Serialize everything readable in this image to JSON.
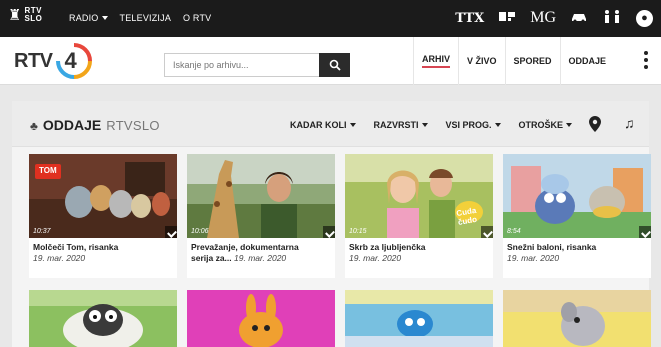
{
  "topbar": {
    "logo_text_top": "RTV",
    "logo_text_bottom": "SLO",
    "nav": [
      {
        "label": "RADIO",
        "dropdown": true
      },
      {
        "label": "TELEVIZIJA",
        "dropdown": false
      },
      {
        "label": "O RTV",
        "dropdown": false
      }
    ],
    "ttx_label": "TTX",
    "mg_label": "MG"
  },
  "header": {
    "brand_rtv": "RTV",
    "brand_num": "4",
    "search_placeholder": "Iskanje po arhivu...",
    "nav": [
      "ARHIV",
      "V ŽIVO",
      "SPORED",
      "ODDAJE"
    ],
    "active_nav": "ARHIV"
  },
  "panel": {
    "title": "ODDAJE",
    "subtitle": "RTVSLO",
    "filters": [
      "KADAR KOLI",
      "RAZVRSTI",
      "VSI PROG.",
      "OTROŠKE"
    ]
  },
  "cards": [
    {
      "title": "Molčeči Tom, risanka",
      "date": "19. mar. 2020",
      "duration": "10:37",
      "thumb_label": "TOM"
    },
    {
      "title": "Prevažanje, dokumentarna serija za...",
      "title_line1": "Prevažanje, dokumentarna",
      "title_line2": "serija za...",
      "date": "19. mar. 2020",
      "duration": "10:06"
    },
    {
      "title": "Skrb za ljubljenčka",
      "date": "19. mar. 2020",
      "duration": "10:15",
      "thumb_label": "Cuda čudo"
    },
    {
      "title": "Snežni baloni, risanka",
      "date": "19. mar. 2020",
      "duration": "8:54"
    }
  ],
  "colors": {
    "accent": "#d64552",
    "topbar": "#1b1b1b"
  }
}
